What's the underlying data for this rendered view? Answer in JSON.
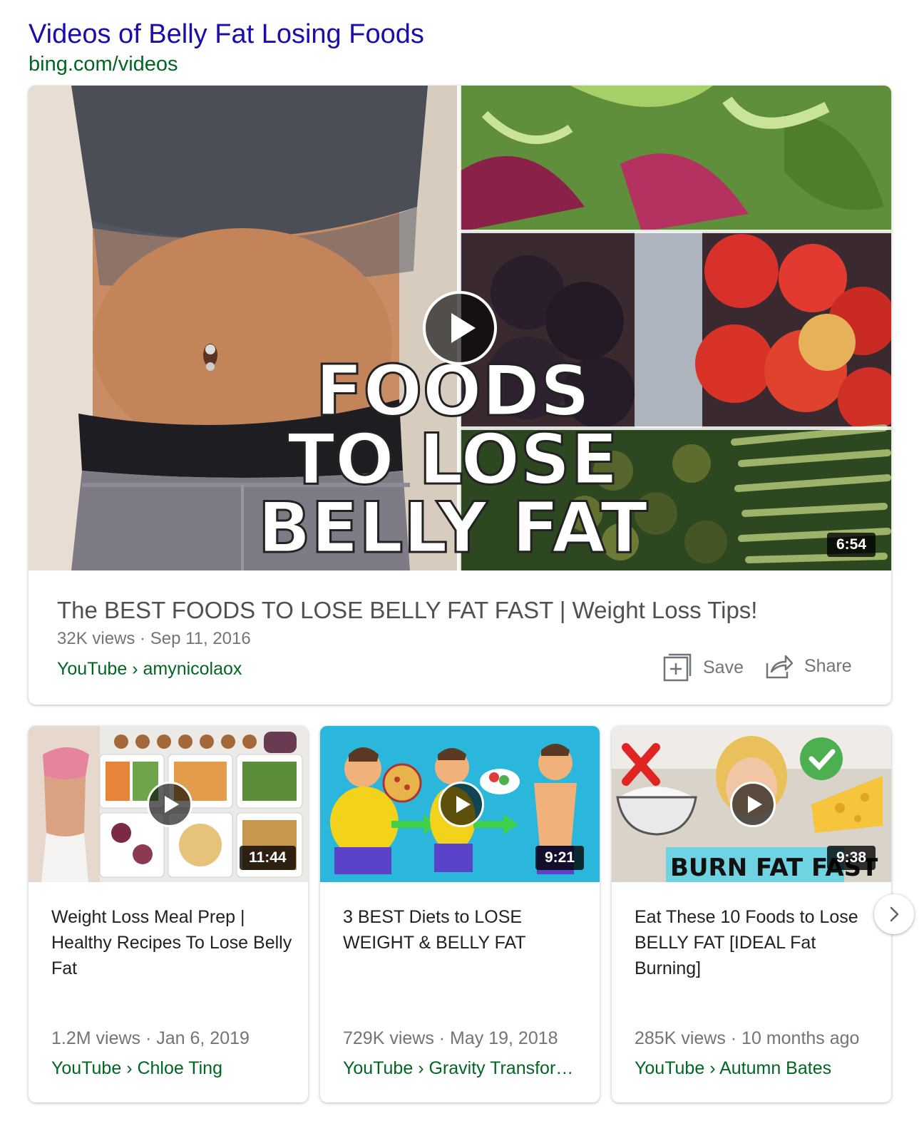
{
  "header": {
    "title": "Videos of Belly Fat Losing Foods",
    "url": "bing.com/videos"
  },
  "featured": {
    "thumbnail_text": [
      "FOODS",
      "TO LOSE",
      "BELLY FAT"
    ],
    "duration": "6:54",
    "title": "The BEST FOODS TO LOSE BELLY FAT FAST | Weight Loss Tips!",
    "meta": "32K views · Sep 11, 2016",
    "source": "YouTube › amynicolaox",
    "save_label": "Save",
    "share_label": "Share"
  },
  "cards": [
    {
      "duration": "11:44",
      "title": "Weight Loss Meal Prep | Healthy Recipes To Lose Belly Fat",
      "meta": "1.2M views · Jan 6, 2019",
      "source": "YouTube › Chloe Ting"
    },
    {
      "duration": "9:21",
      "title": "3 BEST Diets to LOSE WEIGHT & BELLY FAT",
      "meta": "729K views · May 19, 2018",
      "source": "YouTube › Gravity Transfor…"
    },
    {
      "duration": "9:38",
      "thumbnail_text": "BURN FAT FAST",
      "title": "Eat These 10 Foods to Lose BELLY FAT [IDEAL Fat Burning]",
      "meta": "285K views · 10 months ago",
      "source": "YouTube › Autumn Bates"
    }
  ],
  "colors": {
    "link_blue": "#1a0dab",
    "url_green": "#006621",
    "meta_gray": "#70757a"
  }
}
